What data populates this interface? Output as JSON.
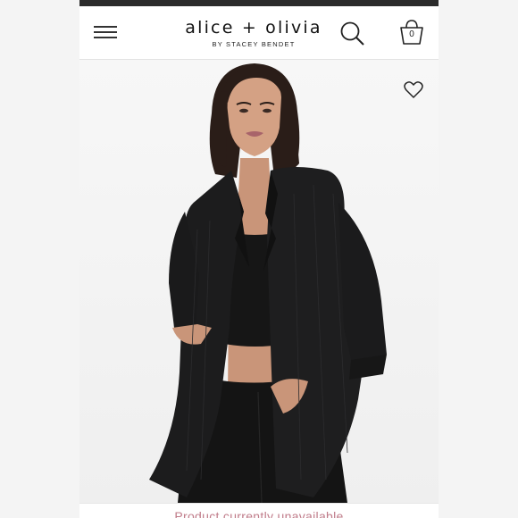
{
  "header": {
    "brand": "alice + olivia",
    "tagline": "BY STACEY BENDET",
    "cart_count": "0"
  },
  "icons": {
    "menu": "hamburger-menu-icon",
    "search": "search-icon",
    "cart": "shopping-bag-icon",
    "favorite": "heart-icon"
  },
  "product": {
    "image": "model-wearing-black-pinstripe-blazer-and-crop-top",
    "status": "Product currently unavailable"
  },
  "colors": {
    "status_text": "#c07c8a",
    "top_bar": "#2b2b2b"
  }
}
